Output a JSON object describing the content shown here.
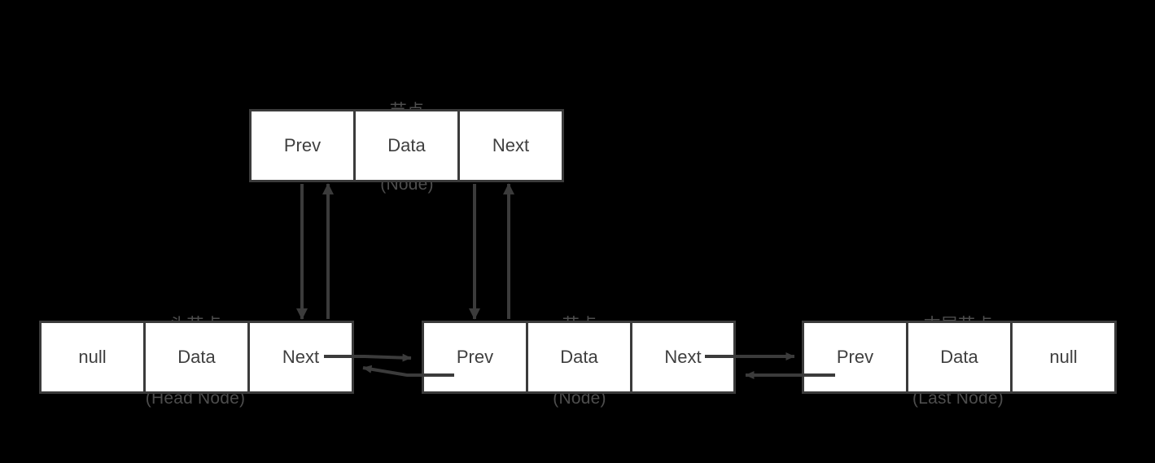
{
  "diagram": {
    "title_semantic": "doubly-linked-list-structure",
    "background_color": "#000000",
    "stroke_color": "#3b3b3b",
    "cell_fill": "#ffffff",
    "cell_text_color": "#3f3f3f",
    "label_text_color": "#4d4d4d"
  },
  "labels": {
    "top_node": {
      "cn": "节点",
      "en": "(Node)"
    },
    "head_node": {
      "cn": "头节点",
      "en": "(Head Node)"
    },
    "middle_node": {
      "cn": "节点",
      "en": "(Node)"
    },
    "last_node": {
      "cn": "末尾节点",
      "en": "(Last Node)"
    }
  },
  "nodes": {
    "top": {
      "name": "node-detail",
      "cells": [
        "Prev",
        "Data",
        "Next"
      ]
    },
    "head": {
      "name": "head-node",
      "cells": [
        "null",
        "Data",
        "Next"
      ]
    },
    "middle": {
      "name": "middle-node",
      "cells": [
        "Prev",
        "Data",
        "Next"
      ]
    },
    "last": {
      "name": "last-node",
      "cells": [
        "Prev",
        "Data",
        "null"
      ]
    }
  },
  "connectors": [
    {
      "name": "head-next-to-middle-prev",
      "direction": "right"
    },
    {
      "name": "middle-prev-to-head-next",
      "direction": "left"
    },
    {
      "name": "middle-next-to-last-prev",
      "direction": "right"
    },
    {
      "name": "last-prev-to-middle-next",
      "direction": "left"
    },
    {
      "name": "detail-prev-to-head-next",
      "direction": "down"
    },
    {
      "name": "head-next-to-detail-prev",
      "direction": "up"
    },
    {
      "name": "detail-next-to-middle-prev",
      "direction": "down"
    },
    {
      "name": "middle-prev-to-detail-next",
      "direction": "up"
    }
  ]
}
